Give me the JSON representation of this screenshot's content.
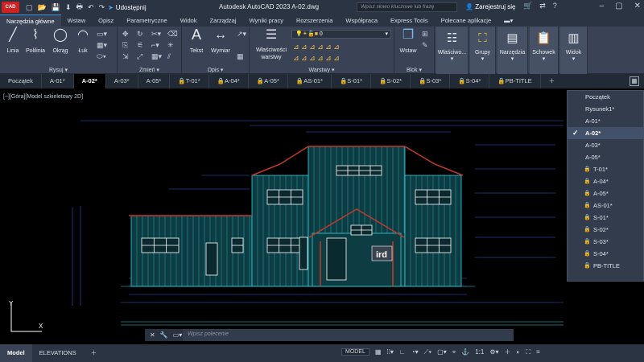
{
  "titlebar": {
    "logo": "CAD",
    "share_label": "Udostępnij",
    "title": "Autodesk AutoCAD 2023    A-02.dwg",
    "search_placeholder": "Wpisz słowo kluczowe lub frazę",
    "signin": "Zarejestruj się"
  },
  "ribbon_tabs": [
    "Narzędzia główne",
    "Wstaw",
    "Opisz",
    "Parametryczne",
    "Widok",
    "Zarządzaj",
    "Wyniki pracy",
    "Rozszerzenia",
    "Współpraca",
    "Express Tools",
    "Polecane aplikacje"
  ],
  "ribbon": {
    "draw": {
      "linia": "Linia",
      "polilinia": "Polilinia",
      "okrag": "Okrąg",
      "luk": "Łuk",
      "title": "Rysuj"
    },
    "modify": {
      "title": "Zmień"
    },
    "annot": {
      "tekst": "Tekst",
      "wymiar": "Wymiar",
      "title": "Opis"
    },
    "layers": {
      "props": "Właściwości warstwy",
      "layer_value": "0",
      "title": "Warstwy"
    },
    "block": {
      "wstaw": "Wstaw",
      "title": "Blok"
    },
    "wlasciwosci": "Właściwo...",
    "grupy": "Grupy",
    "narzedzia": "Narzędzia",
    "schowek": "Schowek",
    "widok": "Widok"
  },
  "file_tabs": [
    "Początek",
    "A-01*",
    "A-02*",
    "A-03*",
    "A-05*",
    "T-01*",
    "A-04*",
    "A-05*",
    "AS-01*",
    "S-01*",
    "S-02*",
    "S-03*",
    "S-04*",
    "PB-TITLE"
  ],
  "active_file_tab": "A-02*",
  "locked_file_tabs": [
    "T-01*",
    "A-04*",
    "A-05*",
    "AS-01*",
    "S-01*",
    "S-02*",
    "S-03*",
    "S-04*",
    "PB-TITLE"
  ],
  "view_label": "[−][Góra][Model szkieletowy 2D]",
  "file_list": [
    {
      "label": "Początek",
      "locked": false,
      "selected": false
    },
    {
      "label": "Rysunek1*",
      "locked": false,
      "selected": false
    },
    {
      "label": "A-01*",
      "locked": false,
      "selected": false
    },
    {
      "label": "A-02*",
      "locked": false,
      "selected": true
    },
    {
      "label": "A-03*",
      "locked": false,
      "selected": false
    },
    {
      "label": "A-05*",
      "locked": false,
      "selected": false
    },
    {
      "label": "T-01*",
      "locked": true,
      "selected": false
    },
    {
      "label": "A-04*",
      "locked": true,
      "selected": false
    },
    {
      "label": "A-05*",
      "locked": true,
      "selected": false
    },
    {
      "label": "AS-01*",
      "locked": true,
      "selected": false
    },
    {
      "label": "S-01*",
      "locked": true,
      "selected": false
    },
    {
      "label": "S-02*",
      "locked": true,
      "selected": false
    },
    {
      "label": "S-03*",
      "locked": true,
      "selected": false
    },
    {
      "label": "S-04*",
      "locked": true,
      "selected": false
    },
    {
      "label": "PB-TITLE",
      "locked": true,
      "selected": false
    }
  ],
  "drawing": {
    "sign_text": "ird",
    "ucs_y": "Y",
    "ucs_x": "X"
  },
  "command": {
    "placeholder": "Wpisz polecenie"
  },
  "layouts": [
    "Model",
    "ELEVATIONS"
  ],
  "status": {
    "model": "MODEL",
    "scale": "1:1"
  },
  "colors": {
    "accent": "#3d8fd8",
    "wall": "#0e3c43",
    "lines": "#2fd3e0",
    "dims": "#2f58d8",
    "roof": "#c0392b"
  }
}
